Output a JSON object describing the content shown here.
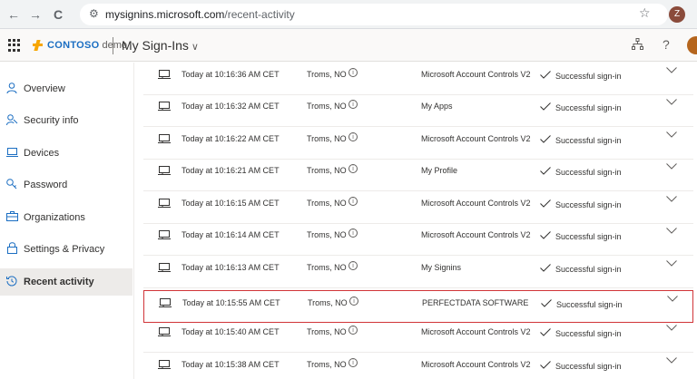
{
  "browser": {
    "back_glyph": "←",
    "forward_glyph": "→",
    "reload_glyph": "C",
    "url_host": "mysignins.microsoft.com",
    "url_path": "/recent-activity",
    "profile_initial": "Z"
  },
  "header": {
    "brand": "CONTOSO",
    "brand_suffix": "demo",
    "title": "My Sign-Ins",
    "title_chevron": "∨",
    "help_glyph": "?"
  },
  "sidebar": {
    "items": [
      {
        "label": "Overview",
        "icon": "person-icon",
        "glyph": "⚲"
      },
      {
        "label": "Security info",
        "icon": "security-info-icon",
        "glyph": "⚷"
      },
      {
        "label": "Devices",
        "icon": "laptop-icon",
        "glyph": "▭"
      },
      {
        "label": "Password",
        "icon": "key-icon",
        "glyph": "⚿"
      },
      {
        "label": "Organizations",
        "icon": "briefcase-icon",
        "glyph": "⊟"
      },
      {
        "label": "Settings & Privacy",
        "icon": "lock-icon",
        "glyph": "⊓"
      },
      {
        "label": "Recent activity",
        "icon": "history-icon",
        "glyph": "↺",
        "active": true
      }
    ]
  },
  "activity": {
    "info_glyph": "i",
    "rows": [
      {
        "time": "Today at 10:16:36 AM CET",
        "location": "Troms, NO",
        "app": "Microsoft Account Controls V2",
        "result": "Successful sign-in"
      },
      {
        "time": "Today at 10:16:32 AM CET",
        "location": "Troms, NO",
        "app": "My Apps",
        "result": "Successful sign-in"
      },
      {
        "time": "Today at 10:16:22 AM CET",
        "location": "Troms, NO",
        "app": "Microsoft Account Controls V2",
        "result": "Successful sign-in"
      },
      {
        "time": "Today at 10:16:21 AM CET",
        "location": "Troms, NO",
        "app": "My Profile",
        "result": "Successful sign-in"
      },
      {
        "time": "Today at 10:16:15 AM CET",
        "location": "Troms, NO",
        "app": "Microsoft Account Controls V2",
        "result": "Successful sign-in"
      },
      {
        "time": "Today at 10:16:14 AM CET",
        "location": "Troms, NO",
        "app": "Microsoft Account Controls V2",
        "result": "Successful sign-in"
      },
      {
        "time": "Today at 10:16:13 AM CET",
        "location": "Troms, NO",
        "app": "My Signins",
        "result": "Successful sign-in"
      },
      {
        "time": "Today at 10:15:55 AM CET",
        "location": "Troms, NO",
        "app": "PERFECTDATA SOFTWARE",
        "result": "Successful sign-in",
        "highlighted": true
      },
      {
        "time": "Today at 10:15:40 AM CET",
        "location": "Troms, NO",
        "app": "Microsoft Account Controls V2",
        "result": "Successful sign-in"
      },
      {
        "time": "Today at 10:15:38 AM CET",
        "location": "Troms, NO",
        "app": "Microsoft Account Controls V2",
        "result": "Successful sign-in"
      }
    ]
  },
  "colors": {
    "accent": "#1b6ec2",
    "highlight_border": "#d13438",
    "brand_mark": "#f7a600"
  }
}
